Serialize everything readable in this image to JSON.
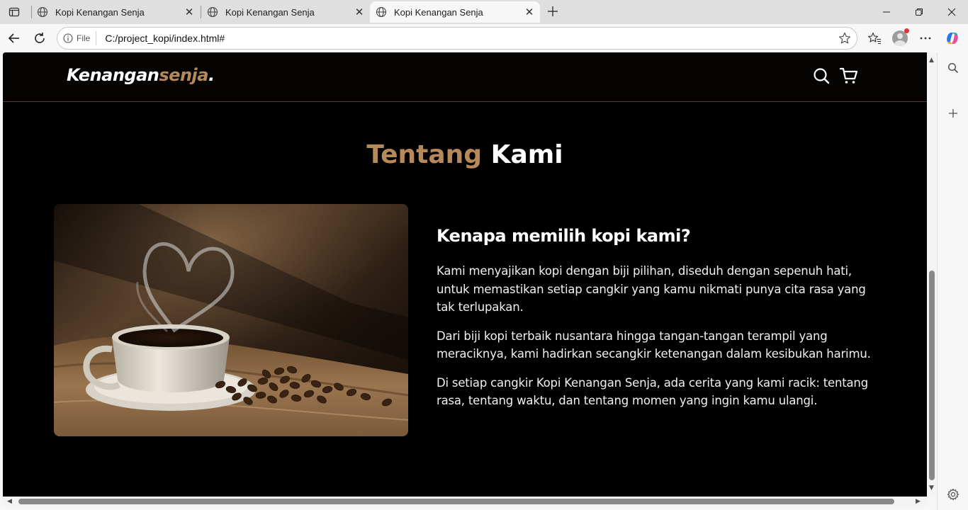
{
  "browser": {
    "tabs": [
      {
        "title": "Kopi Kenangan Senja",
        "active": false
      },
      {
        "title": "Kopi Kenangan Senja",
        "active": false
      },
      {
        "title": "Kopi Kenangan Senja",
        "active": true
      }
    ],
    "address": {
      "scheme_label": "File",
      "url": "C:/project_kopi/index.html#"
    }
  },
  "site": {
    "logo": {
      "main": "Kenangan",
      "accent": "senja",
      "dot": "."
    },
    "section": {
      "title_accent": "Tentang",
      "title_main": "Kami"
    },
    "about": {
      "heading": "Kenapa memilih kopi kami?",
      "paragraphs": [
        "Kami menyajikan kopi dengan biji pilihan, diseduh dengan sepenuh hati, untuk memastikan setiap cangkir yang kamu nikmati punya cita rasa yang tak terlupakan.",
        "Dari biji kopi terbaik nusantara hingga tangan-tangan terampil yang meraciknya, kami hadirkan secangkir ketenangan dalam kesibukan harimu.",
        "Di setiap cangkir Kopi Kenangan Senja, ada cerita yang kami racik: tentang rasa, tentang waktu, dan tentang momen yang ingin kamu ulangi."
      ]
    }
  },
  "icons": {
    "tab": "globe-icon",
    "navbar": [
      "search-icon",
      "cart-icon"
    ]
  },
  "colors": {
    "accent": "#b6895b",
    "background": "#000000",
    "text": "#ffffff"
  }
}
